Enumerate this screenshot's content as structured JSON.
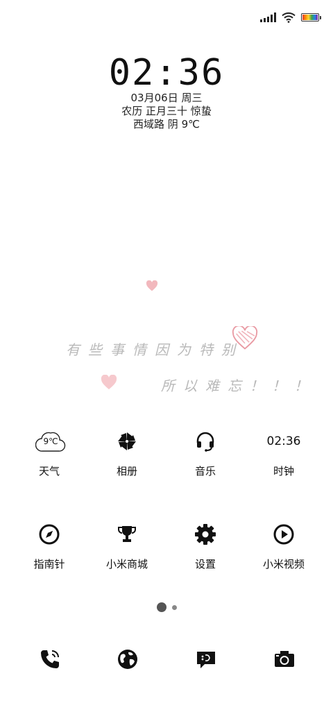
{
  "status_bar": {
    "signal_icon": "signal-bars-icon",
    "wifi_icon": "wifi-icon",
    "battery_icon": "battery-icon",
    "battery_colors": [
      "#e53935",
      "#fb8c00",
      "#fdd835",
      "#43a047",
      "#1e88e5",
      "#8e24aa"
    ]
  },
  "lock_clock": {
    "time": "02:36",
    "date": "03月06日 周三",
    "lunar": "农历 正月三十 惊蛰",
    "weather": "西域路 阴 9℃"
  },
  "wallpaper": {
    "line1": "有些事情因为特别",
    "line2": "所以难忘！！！",
    "heart_color": "#f2b8bd"
  },
  "apps": [
    {
      "label": "天气",
      "icon": "weather-cloud-icon",
      "icon_text": "9℃"
    },
    {
      "label": "相册",
      "icon": "pinwheel-icon"
    },
    {
      "label": "音乐",
      "icon": "headphones-icon"
    },
    {
      "label": "时钟",
      "icon": "clock-icon",
      "icon_text": "02:36"
    },
    {
      "label": "指南针",
      "icon": "compass-icon"
    },
    {
      "label": "小米商城",
      "icon": "trophy-icon"
    },
    {
      "label": "设置",
      "icon": "gear-icon"
    },
    {
      "label": "小米视频",
      "icon": "play-icon"
    }
  ],
  "page_indicator": {
    "pages": 2,
    "current_page": 1
  },
  "dock": [
    {
      "icon": "phone-icon"
    },
    {
      "icon": "browser-globe-icon"
    },
    {
      "icon": "message-icon"
    },
    {
      "icon": "camera-icon"
    }
  ]
}
